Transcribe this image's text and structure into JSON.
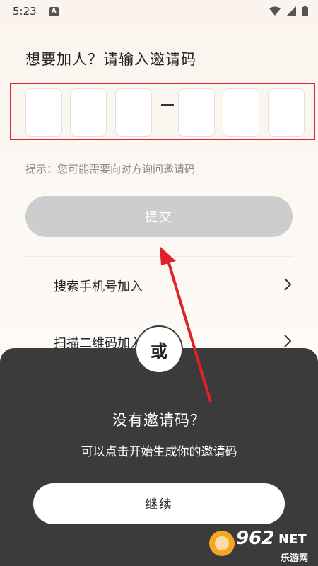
{
  "status": {
    "time": "5:23",
    "notification_icon_text": "A"
  },
  "prompt": {
    "title": "想要加人？请输入邀请码"
  },
  "code": {
    "cells": [
      "",
      "",
      "",
      "",
      "",
      ""
    ]
  },
  "hint": {
    "text": "提示：您可能需要向对方询问邀请码"
  },
  "submit": {
    "label": "提交"
  },
  "options": [
    {
      "label": "搜索手机号加入"
    },
    {
      "label": "扫描二维码加入"
    }
  ],
  "sheet": {
    "or_label": "或",
    "title": "没有邀请码？",
    "subtitle": "可以点击开始生成你的邀请码",
    "continue_label": "继续"
  },
  "watermark": {
    "numeral": "962",
    "suffix": "NET",
    "site": "乐游网"
  },
  "colors": {
    "highlight": "#e0202a",
    "sheet_bg": "#3b3b3b",
    "submit_disabled": "#cdcdcd"
  }
}
